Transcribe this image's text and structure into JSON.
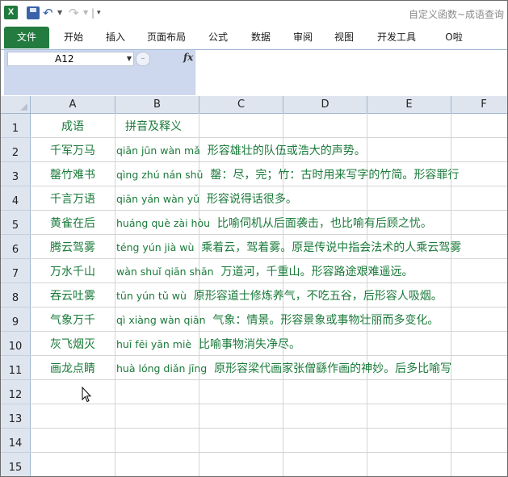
{
  "window": {
    "app_icon": "X",
    "title": "自定义函数~成语查询"
  },
  "quick_access": {
    "save": "save-icon",
    "undo": "↶",
    "redo": "↷",
    "customize": "▾"
  },
  "ribbon": {
    "tabs": [
      "文件",
      "开始",
      "插入",
      "页面布局",
      "公式",
      "数据",
      "审阅",
      "视图",
      "开发工具",
      "O啦"
    ]
  },
  "formula_bar": {
    "name_box": "A12",
    "fx_label": "fx",
    "formula": ""
  },
  "sheet": {
    "columns": [
      "A",
      "B",
      "C",
      "D",
      "E",
      "F"
    ],
    "rows": [
      "1",
      "2",
      "3",
      "4",
      "5",
      "6",
      "7",
      "8",
      "9",
      "10",
      "11",
      "12",
      "13",
      "14",
      "15"
    ],
    "header": {
      "a": "成语",
      "b": "拼音及释义"
    },
    "data": [
      {
        "idiom": "千军万马",
        "pinyin": "qiān jūn wàn mǎ",
        "meaning": "形容雄壮的队伍或浩大的声势。"
      },
      {
        "idiom": "罄竹难书",
        "pinyin": "qìng zhú nán shū",
        "meaning": "罄：尽，完；竹：古时用来写字的竹简。形容罪行"
      },
      {
        "idiom": "千言万语",
        "pinyin": "qiān yán wàn yǔ",
        "meaning": "形容说得话很多。"
      },
      {
        "idiom": "黄雀在后",
        "pinyin": "huáng què zài hòu",
        "meaning": "比喻伺机从后面袭击，也比喻有后顾之忧。"
      },
      {
        "idiom": "腾云驾雾",
        "pinyin": "téng yún jià wù",
        "meaning": "乘着云，驾着雾。原是传说中指会法术的人乘云驾雾"
      },
      {
        "idiom": "万水千山",
        "pinyin": "wàn shuǐ qiān shān",
        "meaning": "万道河，千重山。形容路途艰难遥远。"
      },
      {
        "idiom": "吞云吐雾",
        "pinyin": "tūn yún tǔ wù",
        "meaning": "原形容道士修炼养气，不吃五谷，后形容人吸烟。"
      },
      {
        "idiom": "气象万千",
        "pinyin": "qì xiàng wàn qiān",
        "meaning": "气象：情景。形容景象或事物壮丽而多变化。"
      },
      {
        "idiom": "灰飞烟灭",
        "pinyin": "huī fēi yān miè",
        "meaning": "比喻事物消失净尽。"
      },
      {
        "idiom": "画龙点睛",
        "pinyin": "huà lóng diǎn jīng",
        "meaning": "原形容梁代画家张僧繇作画的神妙。后多比喻写"
      }
    ]
  }
}
